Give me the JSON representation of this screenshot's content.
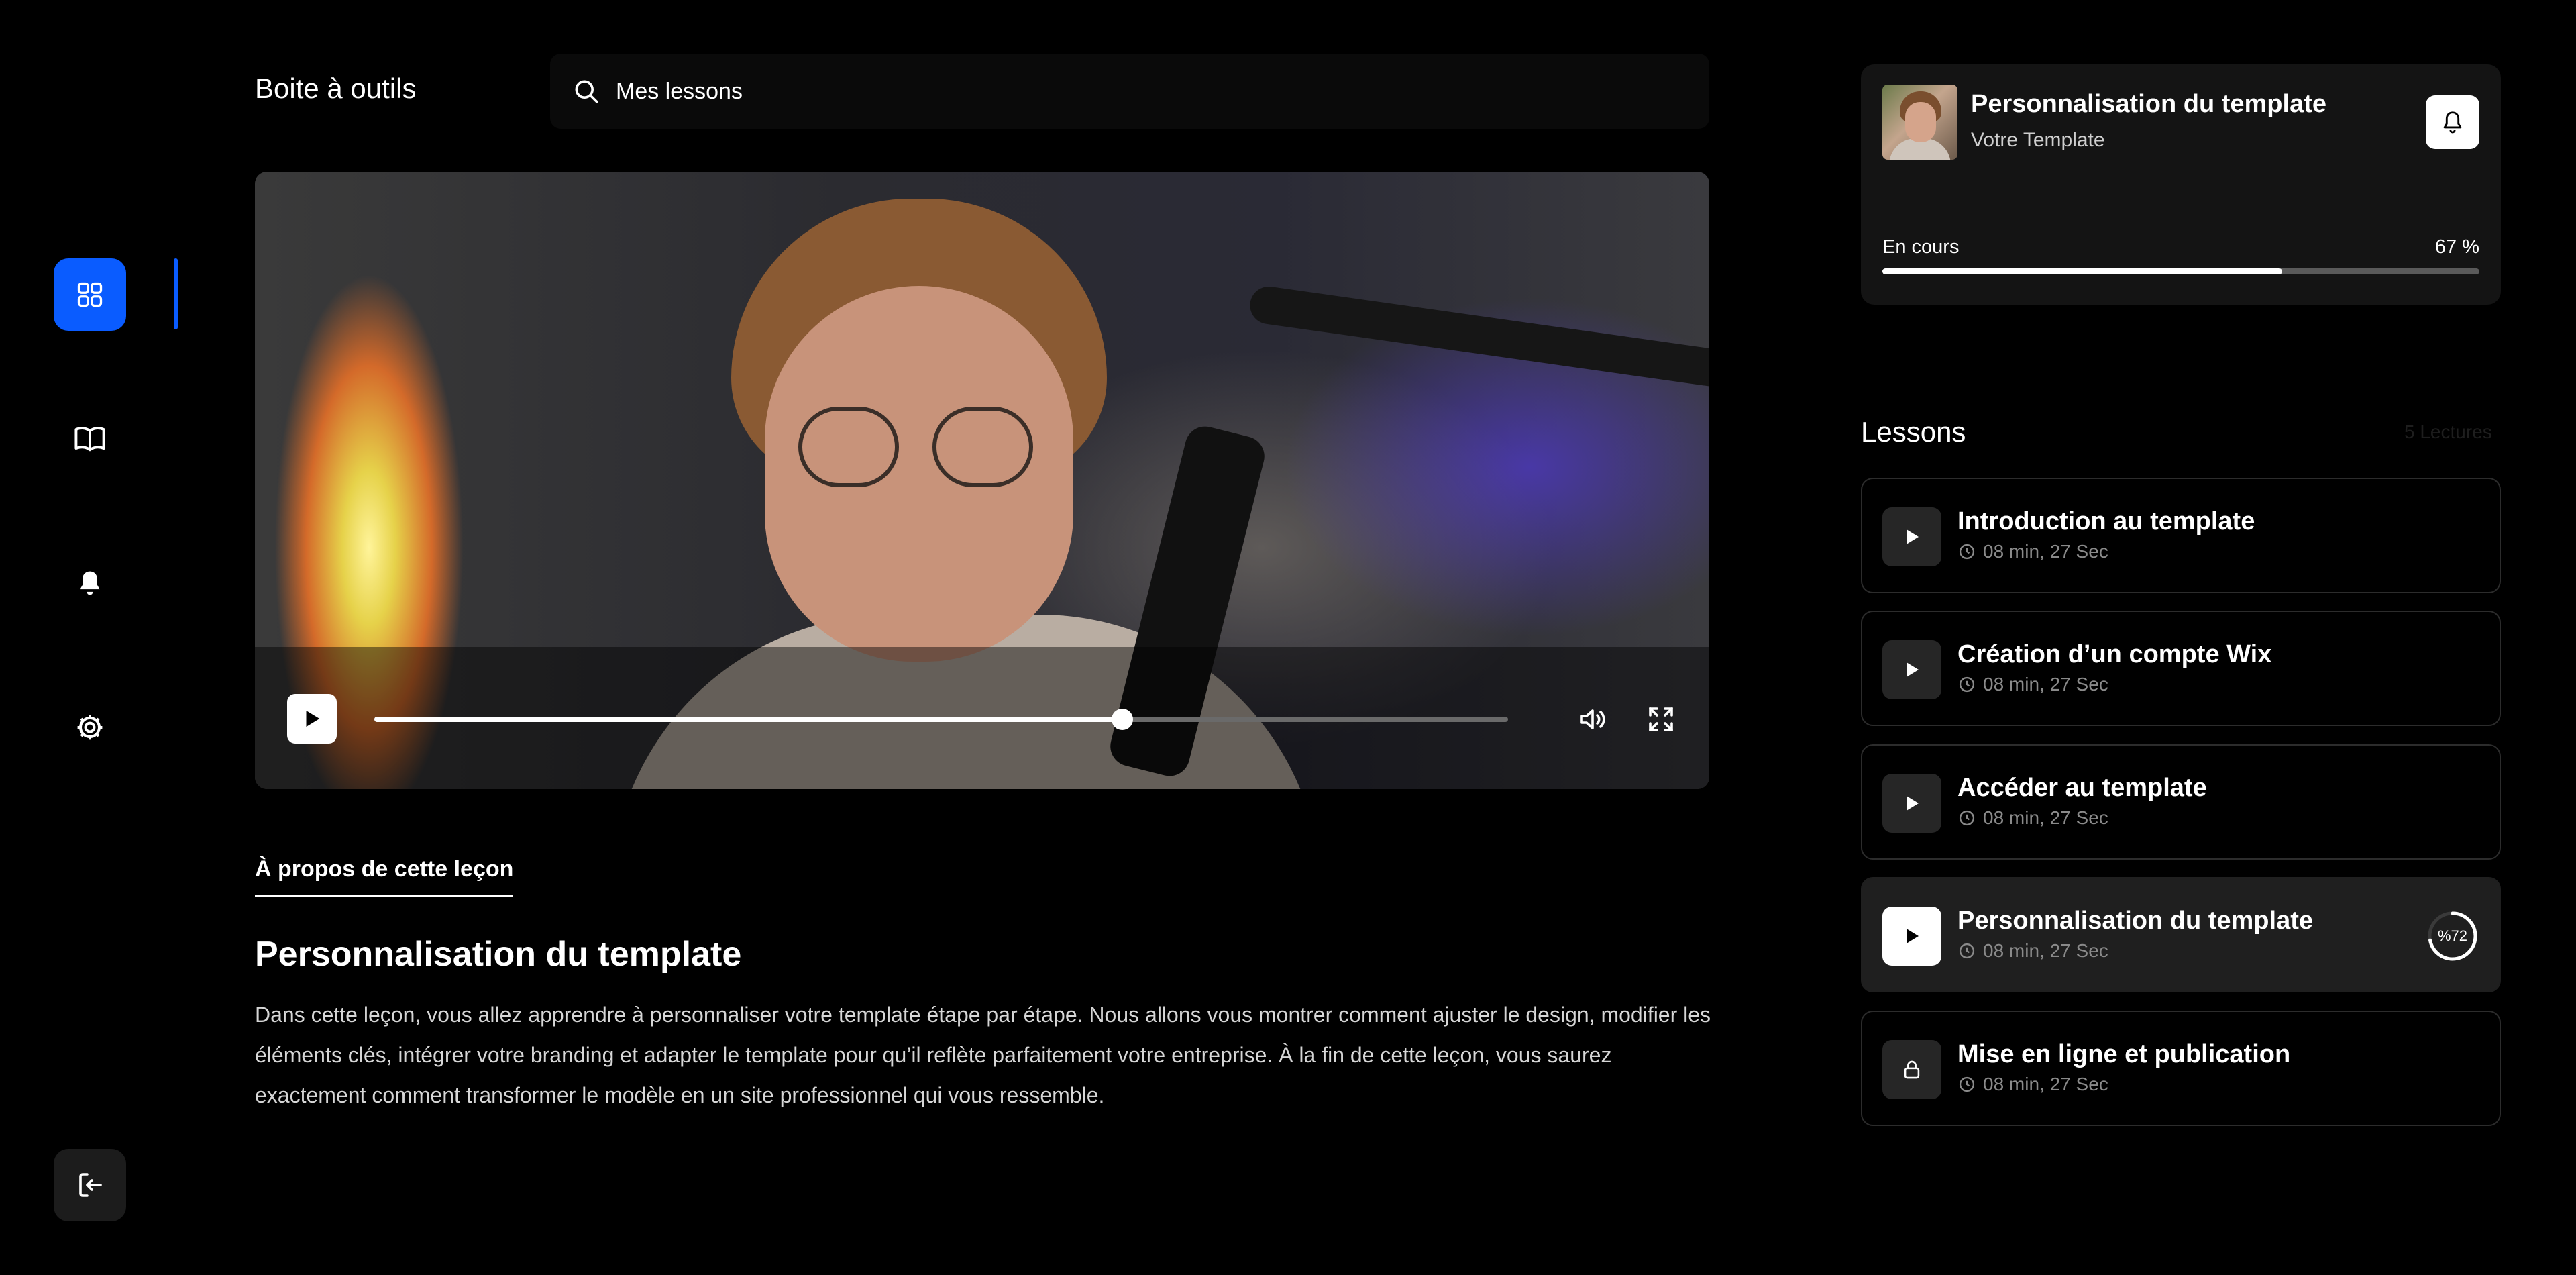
{
  "topbar": {
    "title": "Boite à outils",
    "search_label": "Mes lessons"
  },
  "sidebar": {
    "items": [
      {
        "icon": "grid-icon",
        "active": true
      },
      {
        "icon": "book-icon",
        "active": false
      },
      {
        "icon": "bell-icon",
        "active": false
      },
      {
        "icon": "gear-icon",
        "active": false
      }
    ],
    "logout_icon": "logout-icon"
  },
  "player": {
    "progress": 0.66,
    "playing": false
  },
  "about": {
    "tab_label": "À propos de cette leçon",
    "title": "Personnalisation du template",
    "description": "Dans cette leçon, vous allez apprendre à personnaliser votre template étape par étape. Nous allons vous montrer comment ajuster le design, modifier les éléments clés, intégrer votre branding et adapter le template pour qu’il reflète parfaitement votre entreprise. À la fin de cette leçon, vous saurez exactement comment transformer le modèle en un site professionnel qui vous ressemble."
  },
  "current": {
    "title": "Personnalisation du template",
    "subtitle": "Votre Template",
    "status_label": "En cours",
    "progress_label": "67 %",
    "progress": 0.67
  },
  "lessons": {
    "heading": "Lessons",
    "count_label": "5 Lectures",
    "items": [
      {
        "title": "Introduction au template",
        "duration": "08 min, 27 Sec",
        "state": "play"
      },
      {
        "title": "Création d’un compte Wix",
        "duration": "08 min, 27 Sec",
        "state": "play"
      },
      {
        "title": "Accéder au template",
        "duration": "08 min, 27 Sec",
        "state": "play"
      },
      {
        "title": "Personnalisation du template",
        "duration": "08 min, 27 Sec",
        "state": "active",
        "progress_label": "%72",
        "progress": 0.72
      },
      {
        "title": "Mise en ligne et publication",
        "duration": "08 min, 27 Sec",
        "state": "locked"
      }
    ]
  },
  "colors": {
    "accent": "#0a5cff",
    "background": "#000000",
    "card": "#141414"
  }
}
